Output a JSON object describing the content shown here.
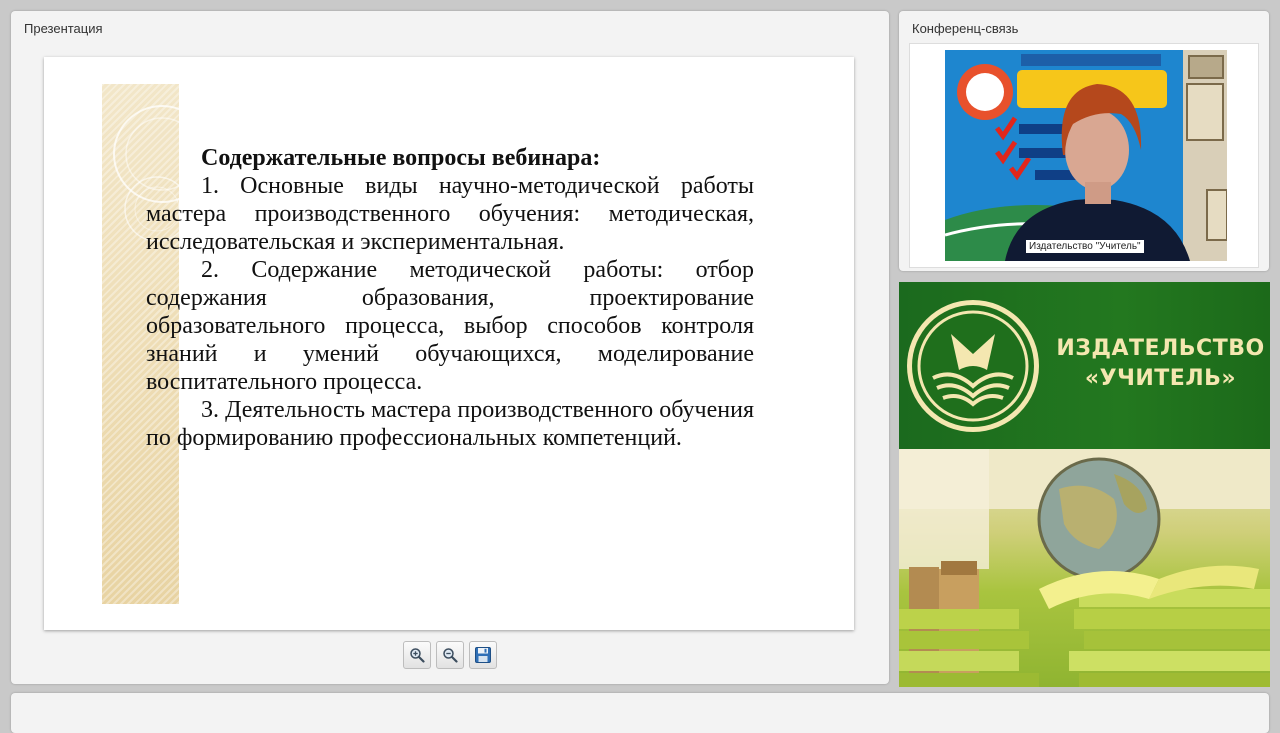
{
  "presentation": {
    "panel_title": "Презентация",
    "slide": {
      "heading": "Содержательные вопросы вебинара:",
      "items": [
        "1. Основные виды научно-методической работы мастера производственного обучения: методическая, исследовательская и экспериментальная.",
        "2. Содержание методической работы: отбор содержания образования, проектирование образовательного процесса, выбор способов контроля знаний и умений обучающихся, моделирование воспитательного процесса.",
        "3. Деятельность мастера производственного обучения по формированию профессиональных компетенций."
      ]
    },
    "toolbar": [
      {
        "name": "zoom-in",
        "icon": "zoom-in-icon"
      },
      {
        "name": "zoom-out",
        "icon": "zoom-out-icon"
      },
      {
        "name": "save",
        "icon": "floppy-disk-icon"
      }
    ]
  },
  "conference": {
    "panel_title": "Конференц-связь",
    "video_label": "Издательство \"Учитель\""
  },
  "publisher": {
    "name_line1": "ИЗДАТЕЛЬСТВО",
    "name_line2": "«УЧИТЕЛЬ»"
  },
  "colors": {
    "banner_green": "#23781f",
    "banner_text": "#f4e7b0"
  }
}
